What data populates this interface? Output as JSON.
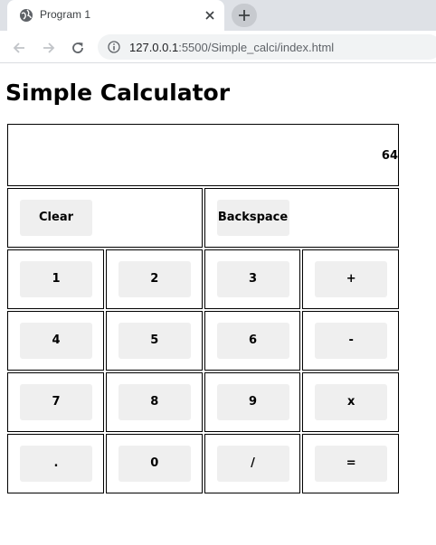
{
  "browser": {
    "tab_title": "Program 1",
    "url_host": "127.0.0.1",
    "url_path": ":5500/Simple_calci/index.html",
    "icons": [
      "globe-icon",
      "close-icon",
      "plus-icon",
      "back-arrow-icon",
      "forward-arrow-icon",
      "reload-icon",
      "info-icon"
    ]
  },
  "page": {
    "title": "Simple Calculator"
  },
  "calculator": {
    "display": "64",
    "clear_label": "Clear",
    "backspace_label": "Backspace",
    "keys": [
      [
        "1",
        "2",
        "3",
        "+"
      ],
      [
        "4",
        "5",
        "6",
        "-"
      ],
      [
        "7",
        "8",
        "9",
        "x"
      ],
      [
        ".",
        "0",
        "/",
        "="
      ]
    ]
  }
}
